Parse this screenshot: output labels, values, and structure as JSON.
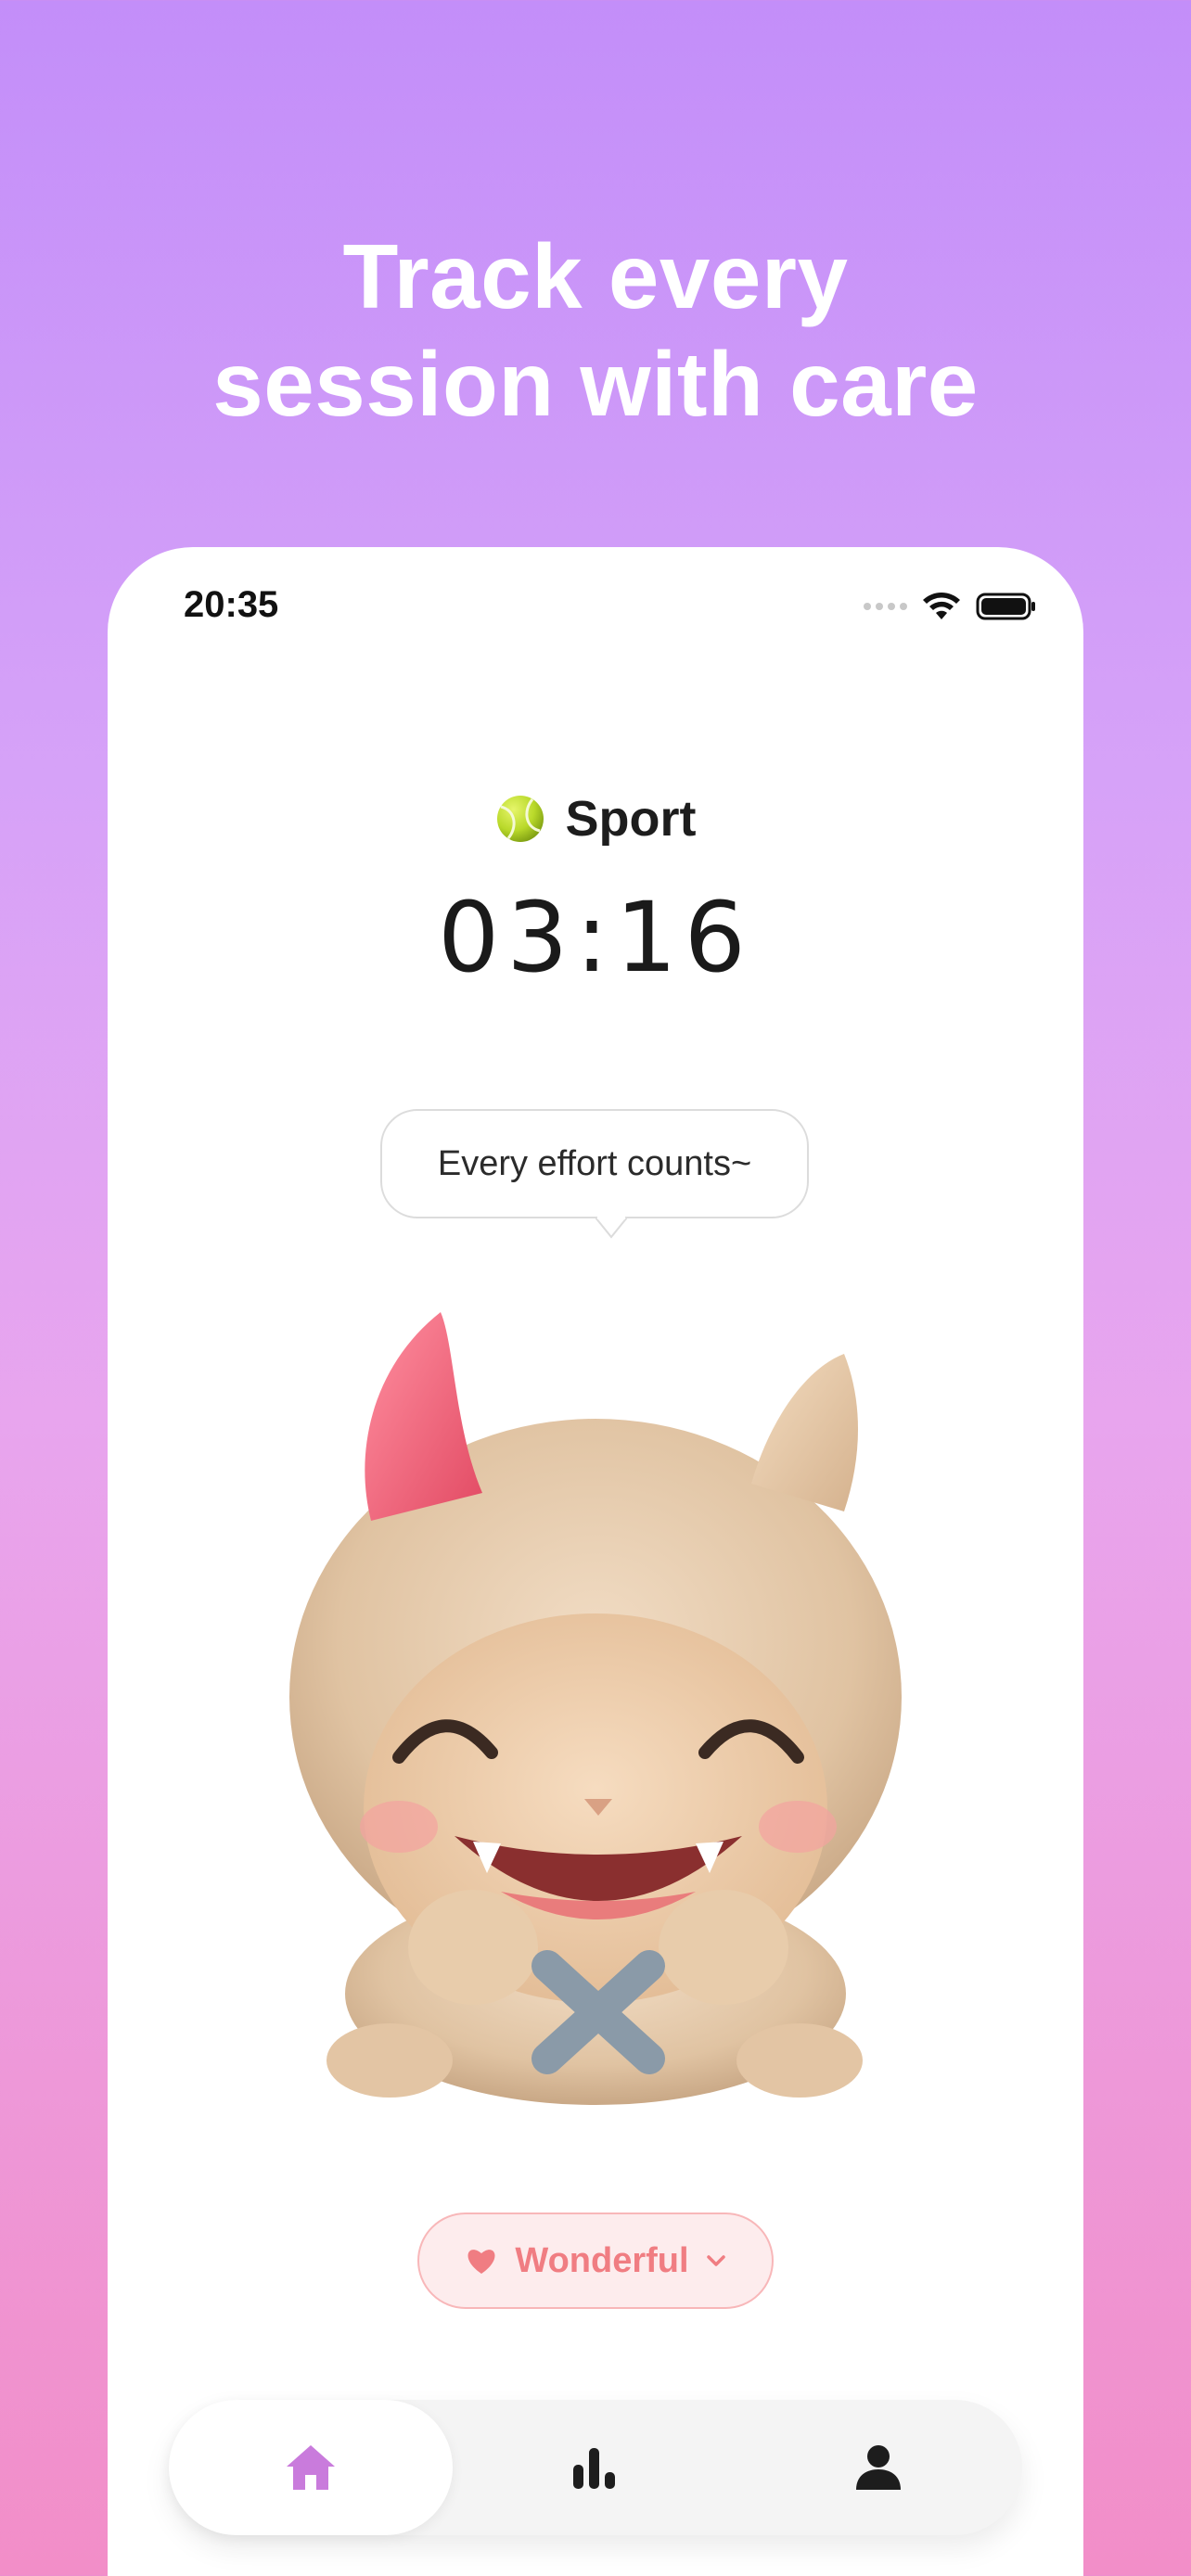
{
  "headline": {
    "line1": "Track every",
    "line2": "session with care"
  },
  "status_bar": {
    "time": "20:35"
  },
  "session": {
    "activity_icon": "tennis-ball",
    "activity_label": "Sport",
    "timer": "03:16"
  },
  "speech_bubble": {
    "text": "Every effort counts~"
  },
  "mood_selector": {
    "icon": "heart",
    "label": "Wonderful"
  },
  "tab_bar": {
    "tabs": [
      {
        "name": "home",
        "icon": "house-icon",
        "active": true
      },
      {
        "name": "stats",
        "icon": "bar-chart-icon",
        "active": false
      },
      {
        "name": "profile",
        "icon": "person-icon",
        "active": false
      }
    ]
  },
  "colors": {
    "accent": "#c97bdc",
    "mood_text": "#f07d82",
    "mood_bg": "#fdeced"
  }
}
